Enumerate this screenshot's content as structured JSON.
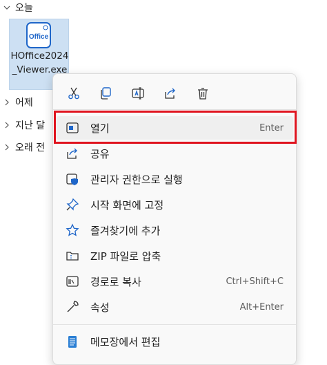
{
  "groups": [
    {
      "label": "오늘",
      "expanded": true
    },
    {
      "label": "어제",
      "expanded": false
    },
    {
      "label": "지난 달",
      "expanded": false
    },
    {
      "label": "오래 전",
      "expanded": false
    }
  ],
  "file": {
    "icon_text": "Office",
    "name": "HOffice2024_Viewer.exe"
  },
  "quick_actions": [
    {
      "name": "cut",
      "icon": "scissors-icon"
    },
    {
      "name": "copy",
      "icon": "copy-icon"
    },
    {
      "name": "rename",
      "icon": "rename-icon"
    },
    {
      "name": "share",
      "icon": "share-icon"
    },
    {
      "name": "delete",
      "icon": "trash-icon"
    }
  ],
  "menu": [
    {
      "label": "열기",
      "shortcut": "Enter",
      "icon": "open-app-icon",
      "selected": true
    },
    {
      "label": "공유",
      "shortcut": "",
      "icon": "share-icon"
    },
    {
      "label": "관리자 권한으로 실행",
      "shortcut": "",
      "icon": "shield-icon"
    },
    {
      "label": "시작 화면에 고정",
      "shortcut": "",
      "icon": "pin-icon"
    },
    {
      "label": "즐겨찾기에 추가",
      "shortcut": "",
      "icon": "star-icon"
    },
    {
      "label": "ZIP 파일로 압축",
      "shortcut": "",
      "icon": "zip-icon"
    },
    {
      "label": "경로로 복사",
      "shortcut": "Ctrl+Shift+C",
      "icon": "path-icon"
    },
    {
      "label": "속성",
      "shortcut": "Alt+Enter",
      "icon": "wrench-icon"
    },
    {
      "label": "메모장에서 편집",
      "shortcut": "",
      "icon": "notepad-icon"
    }
  ],
  "colors": {
    "accent": "#0067c0",
    "highlight": "#e0141f",
    "selection": "#cde0f3"
  }
}
